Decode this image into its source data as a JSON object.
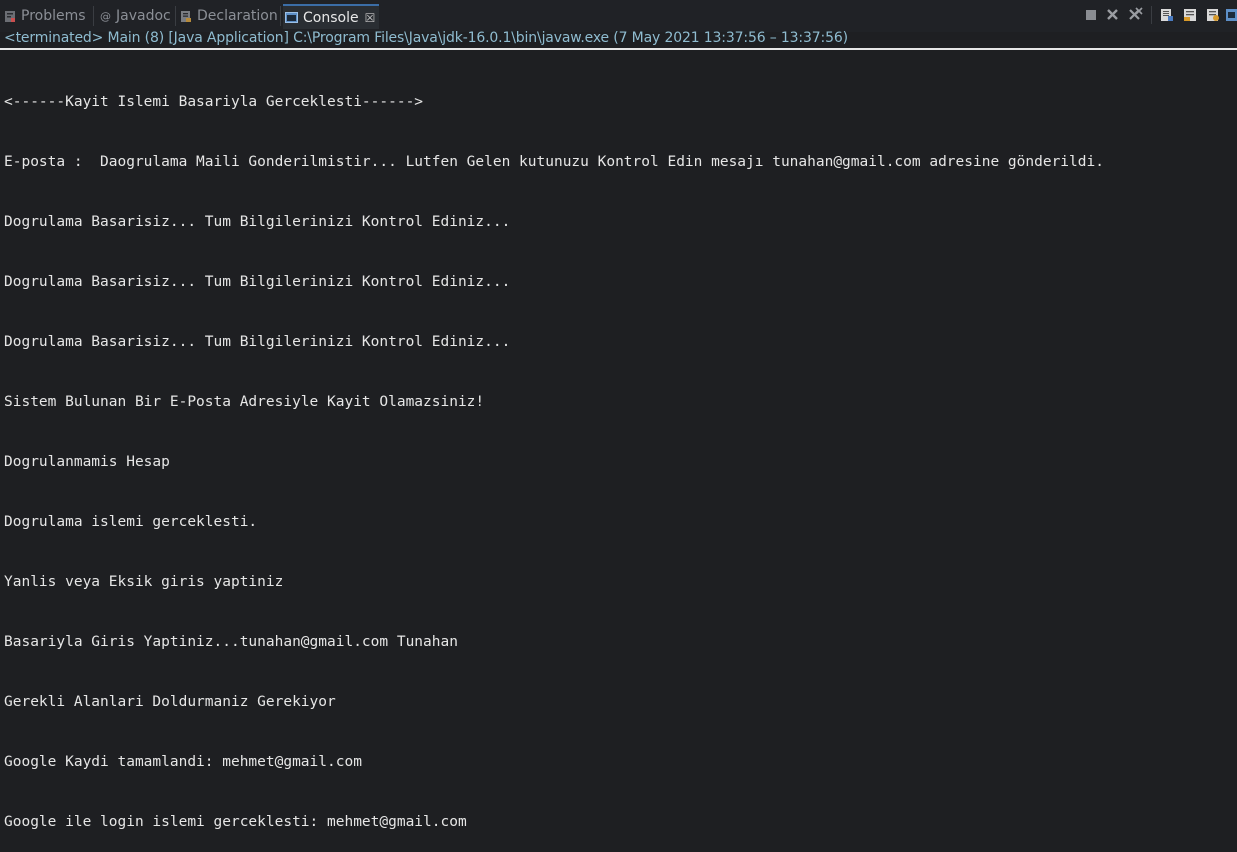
{
  "tabs": [
    {
      "label": "Problems",
      "icon": "problems-icon",
      "active": false
    },
    {
      "label": "Javadoc",
      "icon": "javadoc-icon",
      "active": false
    },
    {
      "label": "Declaration",
      "icon": "declaration-icon",
      "active": false
    },
    {
      "label": "Console",
      "icon": "console-icon",
      "active": true,
      "close": "☒"
    }
  ],
  "toolbar_icons": [
    "terminate-icon",
    "remove-launch-icon",
    "remove-all-terminated-icon",
    "scroll-lock-icon",
    "word-wrap-icon",
    "show-on-output-icon",
    "pin-console-icon"
  ],
  "status": "<terminated> Main (8) [Java Application] C:\\Program Files\\Java\\jdk-16.0.1\\bin\\javaw.exe  (7 May 2021 13:37:56 – 13:37:56)",
  "console_lines": [
    "<------Kayit Islemi Basariyla Gerceklesti------>",
    "E-posta :  Daogrulama Maili Gonderilmistir... Lutfen Gelen kutunuzu Kontrol Edin mesajı tunahan@gmail.com adresine gönderildi.",
    "Dogrulama Basarisiz... Tum Bilgilerinizi Kontrol Ediniz...",
    "Dogrulama Basarisiz... Tum Bilgilerinizi Kontrol Ediniz...",
    "Dogrulama Basarisiz... Tum Bilgilerinizi Kontrol Ediniz...",
    "Sistem Bulunan Bir E-Posta Adresiyle Kayit Olamazsiniz!",
    "Dogrulanmamis Hesap",
    "Dogrulama islemi gerceklesti.",
    "Yanlis veya Eksik giris yaptiniz",
    "Basariyla Giris Yaptiniz...tunahan@gmail.com Tunahan",
    "Gerekli Alanlari Doldurmaniz Gerekiyor",
    "Google Kaydi tamamlandi: mehmet@gmail.com",
    "Google ile login islemi gerceklesti: mehmet@gmail.com"
  ],
  "colors": {
    "background": "#1e1f22",
    "status_text": "#8fbcd0",
    "console_text": "#e6e6e6",
    "active_tab_accent": "#3b6da6"
  }
}
